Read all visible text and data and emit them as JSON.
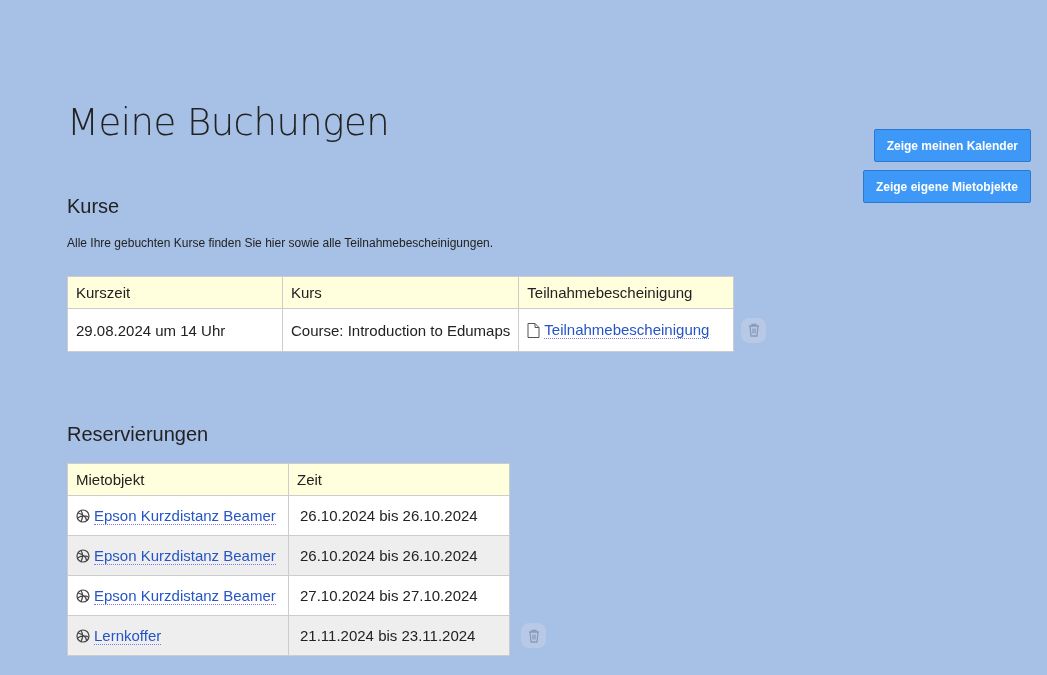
{
  "title": "Meine Buchungen",
  "buttons": [
    "Zeige meinen Kalender",
    "Zeige eigene Mietobjekte"
  ],
  "courses": {
    "heading": "Kurse",
    "intro": "Alle Ihre gebuchten Kurse finden Sie hier sowie alle Teilnahmebescheinigungen.",
    "columns": [
      "Kurszeit",
      "Kurs",
      "Teilnahmebescheinigung"
    ],
    "rows": [
      {
        "time": "29.08.2024 um 14 Uhr",
        "course": "Course: Introduction to Edumaps",
        "certificate": "Teilnahmebescheinigung",
        "deletable": true
      }
    ]
  },
  "reservations": {
    "heading": "Reservierungen",
    "columns": [
      "Mietobjekt",
      "Zeit"
    ],
    "rows": [
      {
        "object": "Epson Kurzdistanz Beamer",
        "time": "26.10.2024 bis 26.10.2024",
        "deletable": false
      },
      {
        "object": "Epson Kurzdistanz Beamer",
        "time": "26.10.2024 bis 26.10.2024",
        "deletable": false
      },
      {
        "object": "Epson Kurzdistanz Beamer",
        "time": "27.10.2024 bis 27.10.2024",
        "deletable": false
      },
      {
        "object": "Lernkoffer",
        "time": "21.11.2024 bis 23.11.2024",
        "deletable": true
      }
    ]
  }
}
